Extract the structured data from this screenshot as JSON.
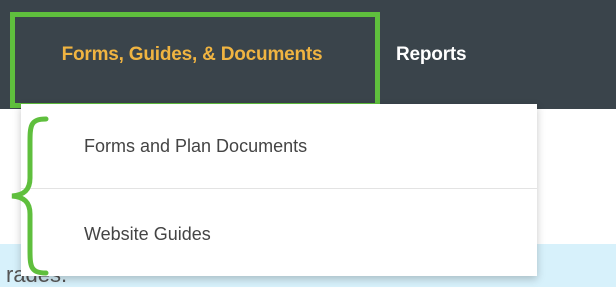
{
  "navbar": {
    "items": [
      {
        "label": "Forms, Guides, & Documents",
        "active": true
      },
      {
        "label": "Reports",
        "active": false
      }
    ]
  },
  "dropdown": {
    "items": [
      {
        "label": "Forms and Plan Documents"
      },
      {
        "label": "Website Guides"
      }
    ]
  },
  "background_text": "rades.",
  "colors": {
    "navbar_bg": "#3a444b",
    "active_text": "#f0b441",
    "highlight": "#5fbf3d",
    "banner_bg": "#d7f1fb"
  }
}
